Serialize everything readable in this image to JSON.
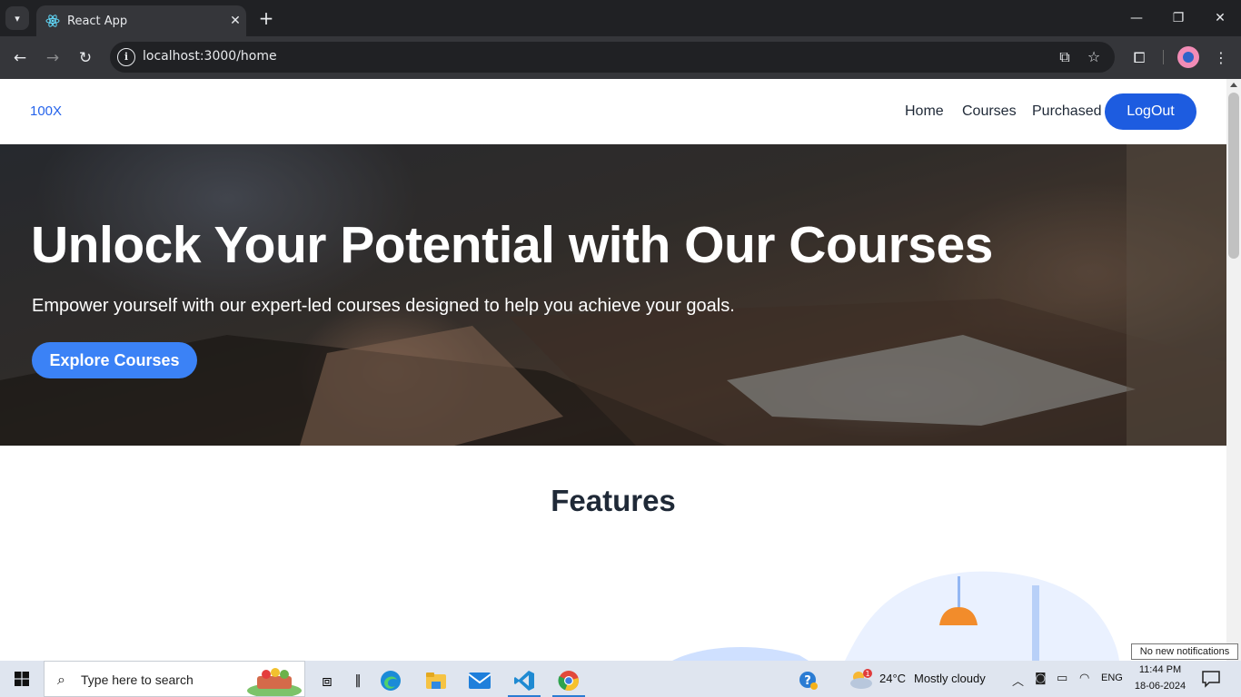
{
  "browser": {
    "tab_title": "React App",
    "url": "localhost:3000/home",
    "icons": [
      "tab-search-icon",
      "react-favicon-icon",
      "close-icon",
      "new-tab-icon",
      "minimize-icon",
      "restore-icon",
      "window-close-icon",
      "back-icon",
      "forward-icon",
      "reload-icon",
      "site-info-icon",
      "install-app-icon",
      "bookmark-star-icon",
      "extensions-icon",
      "profile-avatar",
      "menu-icon"
    ]
  },
  "site": {
    "brand": "100X",
    "nav": {
      "home": "Home",
      "courses": "Courses",
      "purchased": "Purchased",
      "logout": "LogOut"
    },
    "hero": {
      "title": "Unlock Your Potential with Our Courses",
      "subtitle": "Empower yourself with our expert-led courses designed to help you achieve your goals.",
      "cta": "Explore Courses"
    },
    "features_title": "Features",
    "colors": {
      "brand": "#2563eb",
      "logout_button": "#1d5ce0",
      "cta_button": "#3b82f6",
      "heading": "#1f2937"
    }
  },
  "tooltip": "No new notifications",
  "taskbar": {
    "search_placeholder": "Type here to search",
    "weather_temp": "24°C",
    "weather_desc": "Mostly cloudy",
    "weather_badge": "1",
    "language": "ENG",
    "time": "11:44 PM",
    "date": "18-06-2024",
    "apps": [
      "task-view-icon",
      "edge-icon",
      "file-explorer-icon",
      "mail-icon",
      "vscode-icon",
      "chrome-icon"
    ]
  }
}
